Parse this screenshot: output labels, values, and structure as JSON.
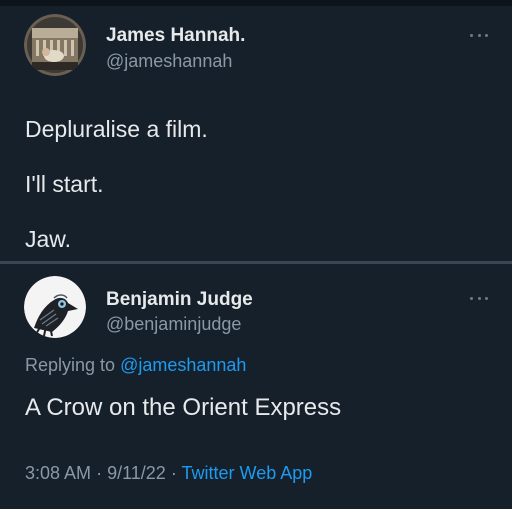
{
  "original_tweet": {
    "display_name": "James Hannah.",
    "handle": "@jameshannah",
    "lines": [
      "Depluralise a film.",
      "I'll start.",
      "Jaw."
    ]
  },
  "reply_tweet": {
    "display_name": "Benjamin Judge",
    "handle": "@benjaminjudge",
    "replying_prefix": "Replying to",
    "replying_to": "@jameshannah",
    "text": "A Crow on the Orient Express",
    "time": "3:08 AM",
    "date": "9/11/22",
    "separator": "·",
    "source": "Twitter Web App"
  },
  "icons": {
    "avatar_1": "profile-photo",
    "avatar_2": "crow-illustration",
    "more": "more-options-icon"
  },
  "colors": {
    "background": "#15202b",
    "text": "#e7e9ea",
    "secondary_text": "#8b98a5",
    "link": "#1d9bf0"
  }
}
